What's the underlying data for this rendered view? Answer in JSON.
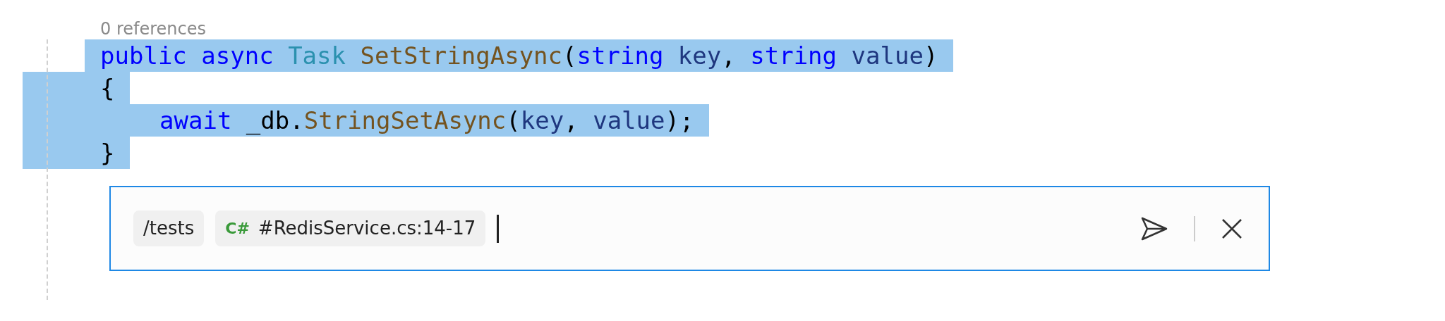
{
  "codelens": "0 references",
  "code_lines": [
    {
      "selected": true,
      "indented": false,
      "tokens": [
        {
          "text": "public ",
          "kind": "keyword"
        },
        {
          "text": "async ",
          "kind": "keyword"
        },
        {
          "text": "Task ",
          "kind": "type"
        },
        {
          "text": "SetStringAsync",
          "kind": "method"
        },
        {
          "text": "(",
          "kind": "plain"
        },
        {
          "text": "string ",
          "kind": "keyword"
        },
        {
          "text": "key",
          "kind": "param"
        },
        {
          "text": ", ",
          "kind": "plain"
        },
        {
          "text": "string ",
          "kind": "keyword"
        },
        {
          "text": "value",
          "kind": "param"
        },
        {
          "text": ")",
          "kind": "plain"
        }
      ]
    },
    {
      "selected": true,
      "indented": false,
      "tokens": [
        {
          "text": "{",
          "kind": "plain"
        }
      ]
    },
    {
      "selected": true,
      "indented": true,
      "tokens": [
        {
          "text": "await ",
          "kind": "keyword"
        },
        {
          "text": "_db.",
          "kind": "plain"
        },
        {
          "text": "StringSetAsync",
          "kind": "method"
        },
        {
          "text": "(",
          "kind": "plain"
        },
        {
          "text": "key",
          "kind": "param"
        },
        {
          "text": ", ",
          "kind": "plain"
        },
        {
          "text": "value",
          "kind": "param"
        },
        {
          "text": ");",
          "kind": "plain"
        }
      ]
    },
    {
      "selected": true,
      "indented": false,
      "tokens": [
        {
          "text": "}",
          "kind": "plain"
        }
      ]
    }
  ],
  "chat": {
    "chips": [
      {
        "kind": "command",
        "label": "/tests"
      },
      {
        "kind": "file",
        "lang": "C#",
        "label": "#RedisService.cs:14-17"
      }
    ]
  }
}
